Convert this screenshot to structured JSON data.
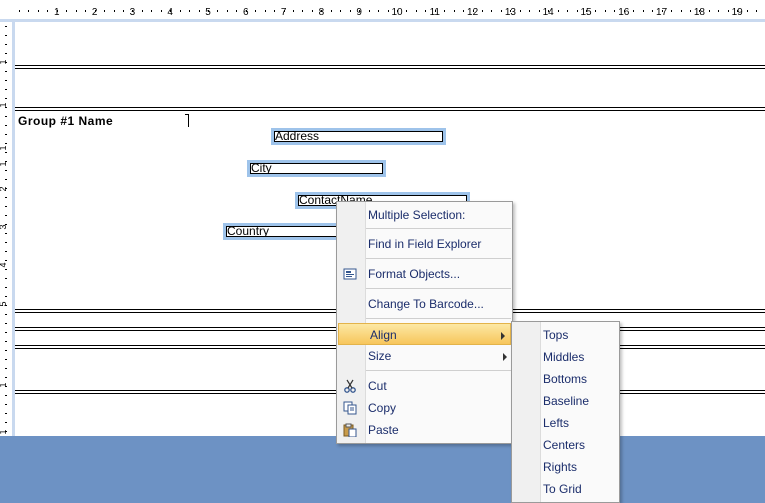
{
  "ruler": {
    "top_numbers": [
      "1",
      "2",
      "3",
      "4",
      "5",
      "6",
      "7",
      "8",
      "9",
      "10",
      "11",
      "12",
      "13",
      "14",
      "15",
      "16",
      "17",
      "18",
      "19"
    ],
    "left_numbers": [
      "1",
      "1",
      "1",
      "1",
      "2",
      "3",
      "4",
      "5",
      "1",
      "1"
    ]
  },
  "report": {
    "group_label": "Group #1 Name",
    "fields": {
      "address": "Address",
      "city": "City",
      "contact": "ContactName",
      "country": "Country"
    }
  },
  "context_menu": {
    "multiple_selection": "Multiple Selection:",
    "find_in_field_explorer": "Find in Field Explorer",
    "format_objects": "Format Objects...",
    "change_to_barcode": "Change To Barcode...",
    "align": "Align",
    "size": "Size",
    "cut": "Cut",
    "copy": "Copy",
    "paste": "Paste"
  },
  "align_submenu": {
    "items": [
      "Tops",
      "Middles",
      "Bottoms",
      "Baseline",
      "Lefts",
      "Centers",
      "Rights",
      "To Grid"
    ]
  },
  "icons": {
    "format_objects": "format-objects-icon",
    "cut": "scissors-icon",
    "copy": "copy-icon",
    "paste": "paste-icon"
  },
  "colors": {
    "selection_border": "#9ec3ea",
    "menu_text": "#1b2d6b",
    "highlight": "#f7c65c",
    "background_area": "#6d92c4"
  }
}
